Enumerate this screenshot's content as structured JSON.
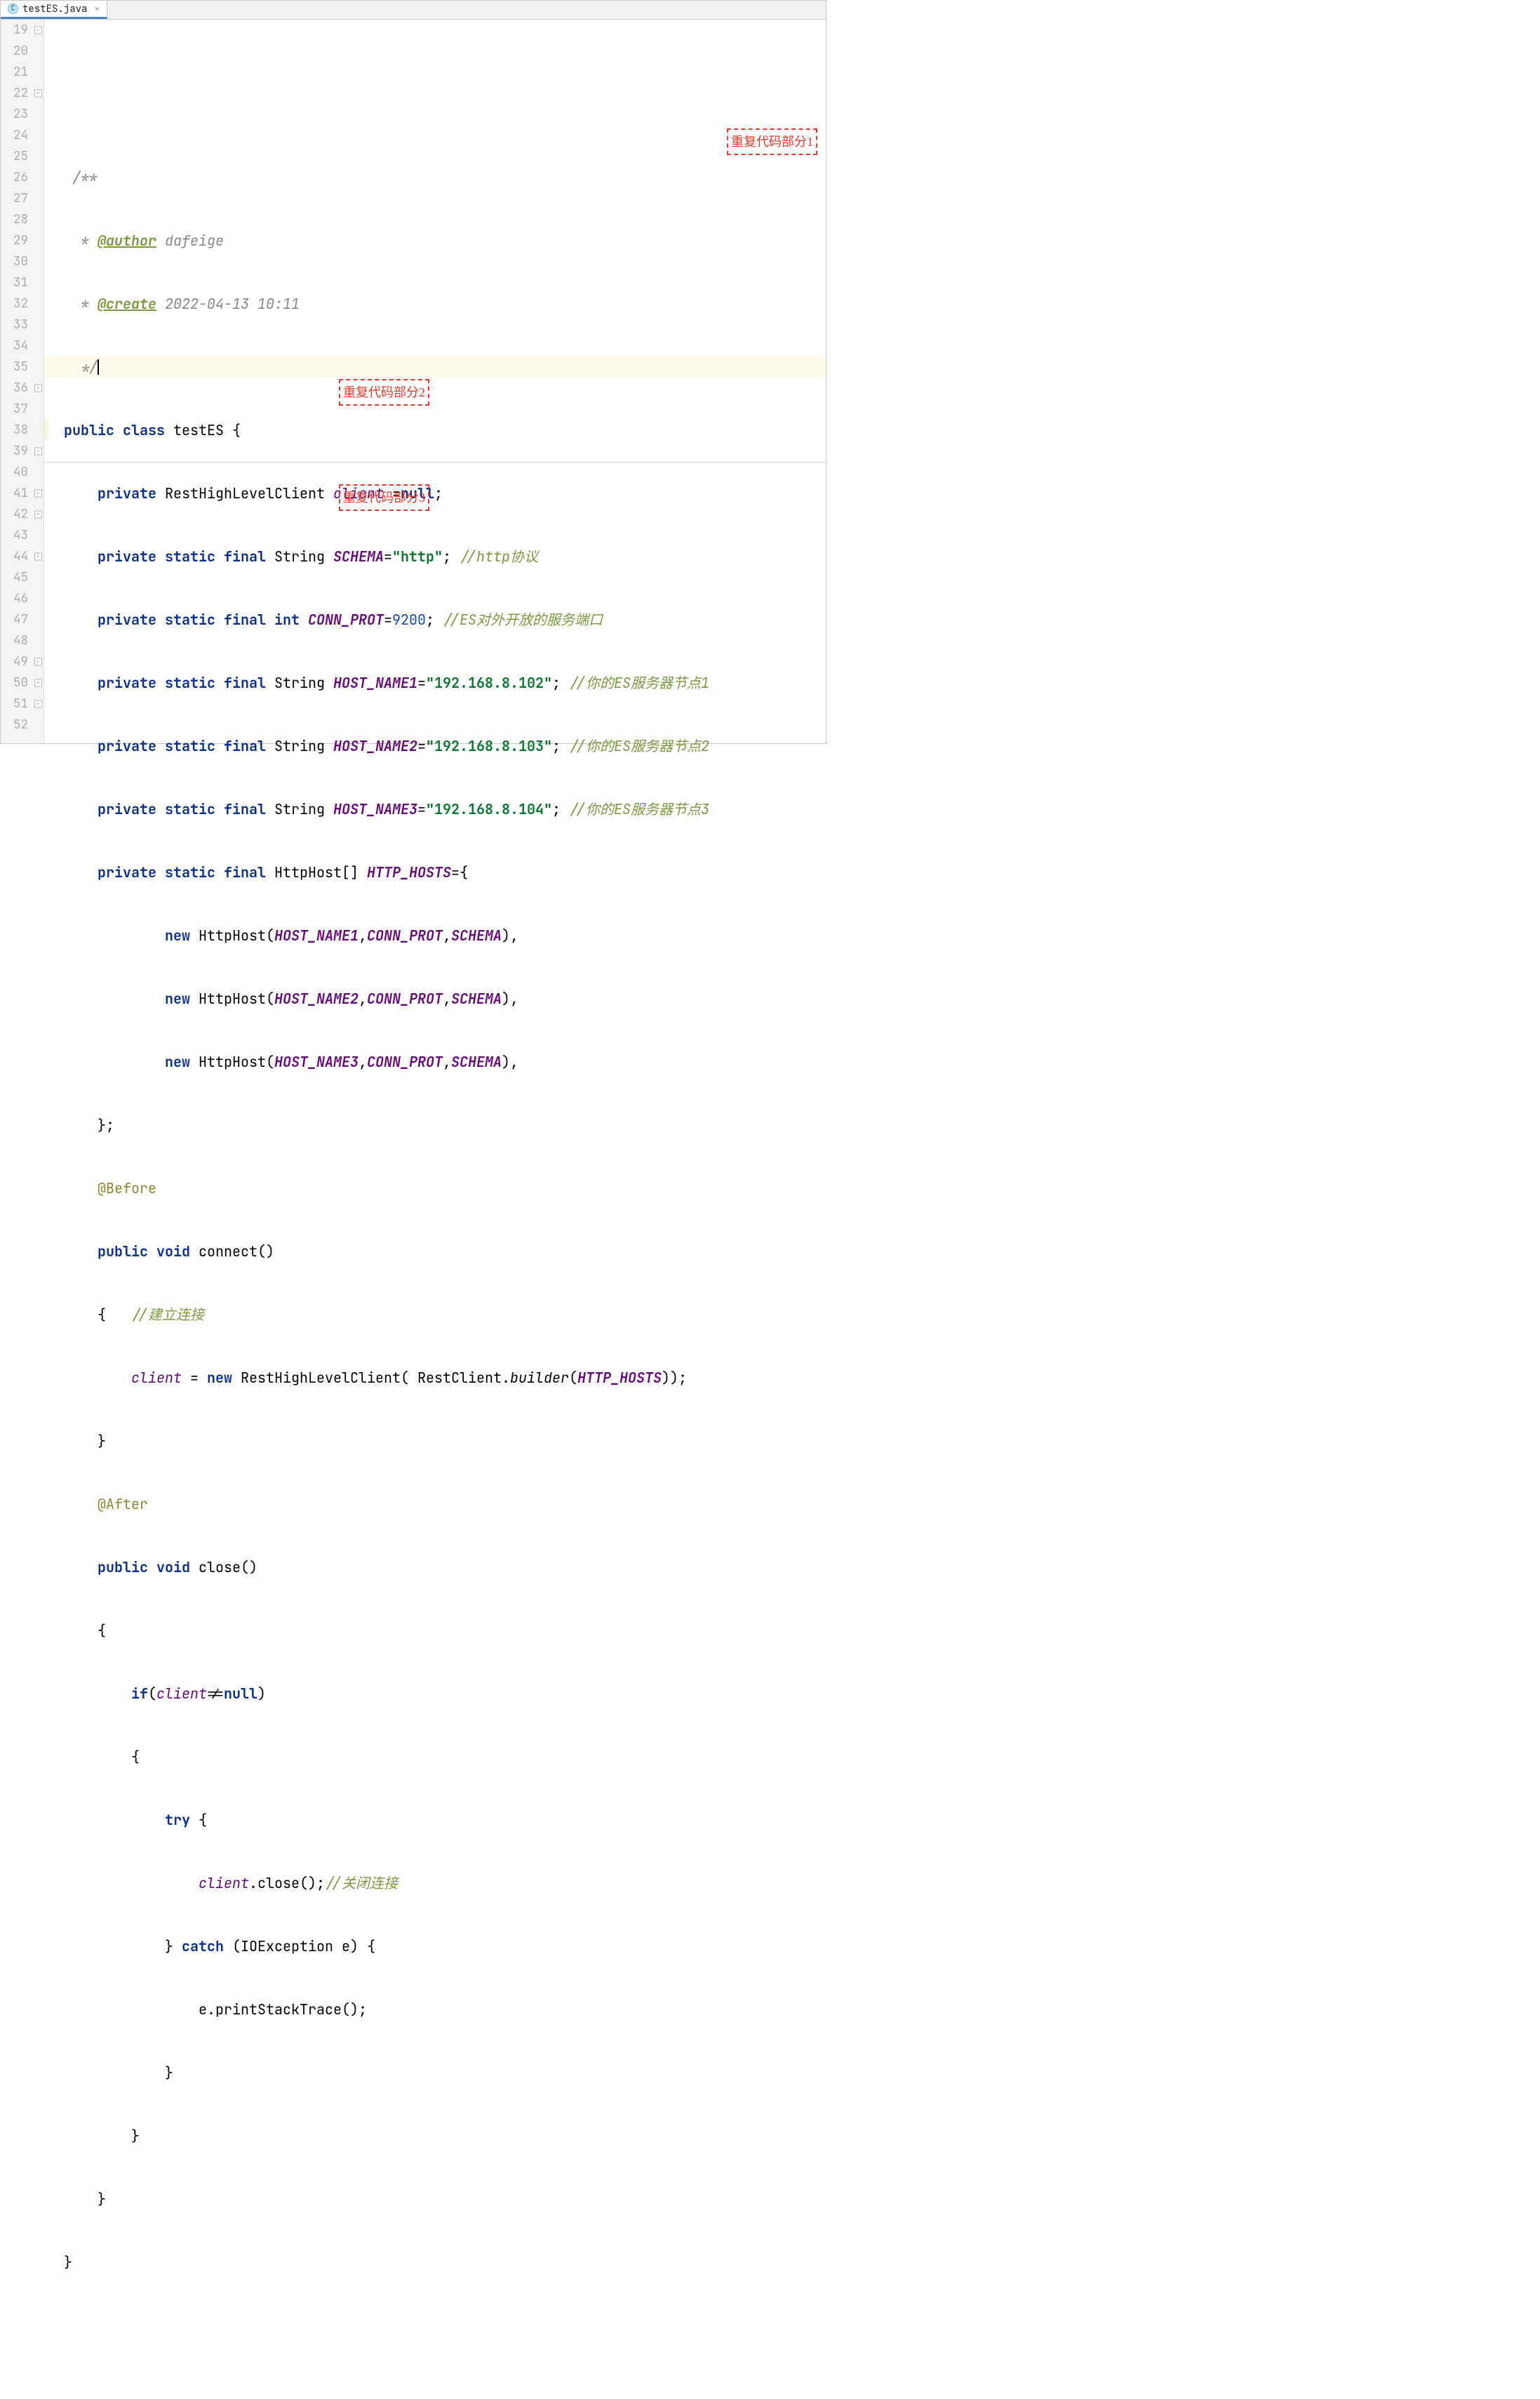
{
  "tab": {
    "icon_letter": "C",
    "filename": "testES.java",
    "close_glyph": "×"
  },
  "gutter": {
    "start": 19,
    "end": 52
  },
  "fold_markers": {
    "19": "−",
    "22": "−",
    "36": "−",
    "39": "−",
    "41": "−",
    "42": "−",
    "44": "−",
    "49": "−",
    "50": "−",
    "51": "−"
  },
  "overlays": {
    "box1": "重复代码部分1",
    "box2": "重复代码部分2",
    "box3": "重复代码部分3"
  },
  "code": {
    "line19": {
      "doc_open": "/**"
    },
    "line20": {
      "star": " * ",
      "tag": "@author",
      "val": " dafeige"
    },
    "line21": {
      "star": " * ",
      "tag": "@create",
      "val": " 2022-04-13 10:11"
    },
    "line22": {
      "doc_close": " */"
    },
    "line23": {
      "kw1": "public",
      "kw2": "class",
      "name": "testES",
      "brace": "{"
    },
    "line24": {
      "kw": "private",
      "type": "RestHighLevelClient",
      "field": "client",
      "eq": " =",
      "val": "null",
      "semi": ";"
    },
    "line25": {
      "kw": "private static final",
      "type": "String",
      "field": "SCHEMA",
      "eq": "=",
      "val": "\"http\"",
      "semi": ";",
      "cmt": "//http协议"
    },
    "line26": {
      "kw": "private static final",
      "type": "int",
      "field": "CONN_PROT",
      "eq": "=",
      "val": "9200",
      "semi": ";",
      "cmt": "//ES对外开放的服务端口"
    },
    "line27": {
      "kw": "private static final",
      "type": "String",
      "field": "HOST_NAME1",
      "eq": "=",
      "val": "\"192.168.8.102\"",
      "semi": ";",
      "cmt": "//你的ES服务器节点1"
    },
    "line28": {
      "kw": "private static final",
      "type": "String",
      "field": "HOST_NAME2",
      "eq": "=",
      "val": "\"192.168.8.103\"",
      "semi": ";",
      "cmt": "//你的ES服务器节点2"
    },
    "line29": {
      "kw": "private static final",
      "type": "String",
      "field": "HOST_NAME3",
      "eq": "=",
      "val": "\"192.168.8.104\"",
      "semi": ";",
      "cmt": "//你的ES服务器节点3"
    },
    "line30": {
      "kw": "private static final",
      "type": "HttpHost[]",
      "field": "HTTP_HOSTS",
      "eq": "=",
      "brace": "{"
    },
    "line31": {
      "kw": "new",
      "type": "HttpHost",
      "args_open": "(",
      "a1": "HOST_NAME1",
      "c1": ",",
      "a2": "CONN_PROT",
      "c2": ",",
      "a3": "SCHEMA",
      "close": "),"
    },
    "line32": {
      "kw": "new",
      "type": "HttpHost",
      "args_open": "(",
      "a1": "HOST_NAME2",
      "c1": ",",
      "a2": "CONN_PROT",
      "c2": ",",
      "a3": "SCHEMA",
      "close": "),"
    },
    "line33": {
      "kw": "new",
      "type": "HttpHost",
      "args_open": "(",
      "a1": "HOST_NAME3",
      "c1": ",",
      "a2": "CONN_PROT",
      "c2": ",",
      "a3": "SCHEMA",
      "close": "),"
    },
    "line34": {
      "brace": "};"
    },
    "line35": {
      "anno": "@Before"
    },
    "line36": {
      "kw": "public void",
      "name": "connect",
      "paren": "()"
    },
    "line37": {
      "brace": "{",
      "cmt": "//建立连接"
    },
    "line38": {
      "field": "client",
      "eq": " = ",
      "kw": "new",
      "type": " RestHighLevelClient( RestClient.",
      "call": "builder",
      "open": "(",
      "arg": "HTTP_HOSTS",
      "close": "));"
    },
    "line39": {
      "brace": "}"
    },
    "line40": {
      "anno": "@After"
    },
    "line41": {
      "kw": "public void",
      "name": "close",
      "paren": "()"
    },
    "line42": {
      "brace": "{"
    },
    "line43": {
      "kw": "if",
      "open": "(",
      "field": "client",
      "neq": "!=",
      "null": "null",
      "close": ")"
    },
    "line44": {
      "brace": "{"
    },
    "line45": {
      "kw": "try",
      "brace": " {"
    },
    "line46": {
      "field": "client",
      "call": ".close();",
      "cmt": "//关闭连接"
    },
    "line47": {
      "brace": "} ",
      "kw": "catch",
      "open": " (IOException e) {",
      "close": ""
    },
    "line48": {
      "call": "e.printStackTrace();"
    },
    "line49": {
      "brace": "}"
    },
    "line50": {
      "brace": "}"
    },
    "line51": {
      "brace": "}"
    },
    "line52": {
      "brace": "}"
    }
  }
}
